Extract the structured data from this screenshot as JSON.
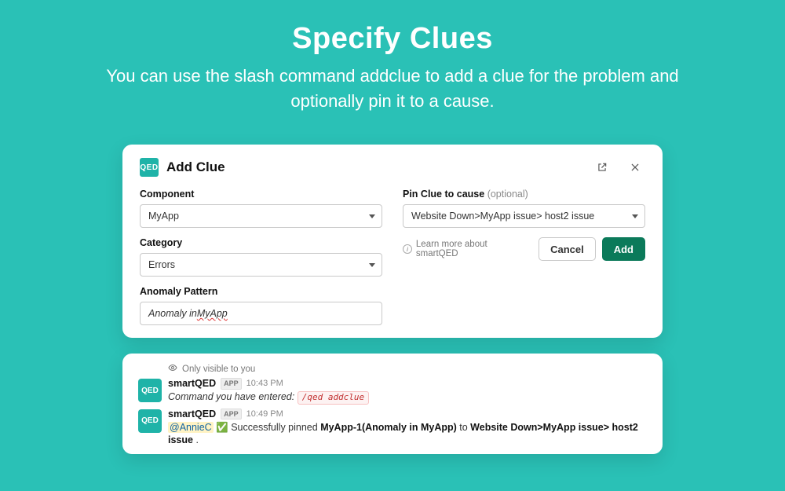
{
  "hero": {
    "title": "Specify Clues",
    "subtitle": "You can use the slash command addclue to add a clue for the problem and optionally pin it to a cause."
  },
  "modal": {
    "title": "Add Clue",
    "badge": "QED",
    "left": {
      "component_label": "Component",
      "component_value": "MyApp",
      "category_label": "Category",
      "category_value": "Errors",
      "anomaly_label": "Anomaly Pattern",
      "anomaly_prefix": "Anomaly in ",
      "anomaly_word": "MyApp"
    },
    "right": {
      "pin_label": "Pin Clue to cause",
      "pin_optional": "(optional)",
      "pin_value": "Website Down>MyApp issue> host2 issue",
      "learn": "Learn more about smartQED",
      "cancel": "Cancel",
      "add": "Add"
    }
  },
  "chat": {
    "visibility": "Only visible to you",
    "badge": "QED",
    "msg1": {
      "name": "smartQED",
      "app": "APP",
      "time": "10:43 PM",
      "text": "Command you have entered:",
      "cmd": "/qed addclue"
    },
    "msg2": {
      "name": "smartQED",
      "app": "APP",
      "time": "10:49 PM",
      "mention": "@AnnieC",
      "check": "✅",
      "t1": " Successfully pinned ",
      "bold1": "MyApp-1(Anomaly in MyApp)",
      "t2": " to  ",
      "bold2": "Website Down>MyApp issue> host2 issue",
      "t3": " ."
    }
  }
}
